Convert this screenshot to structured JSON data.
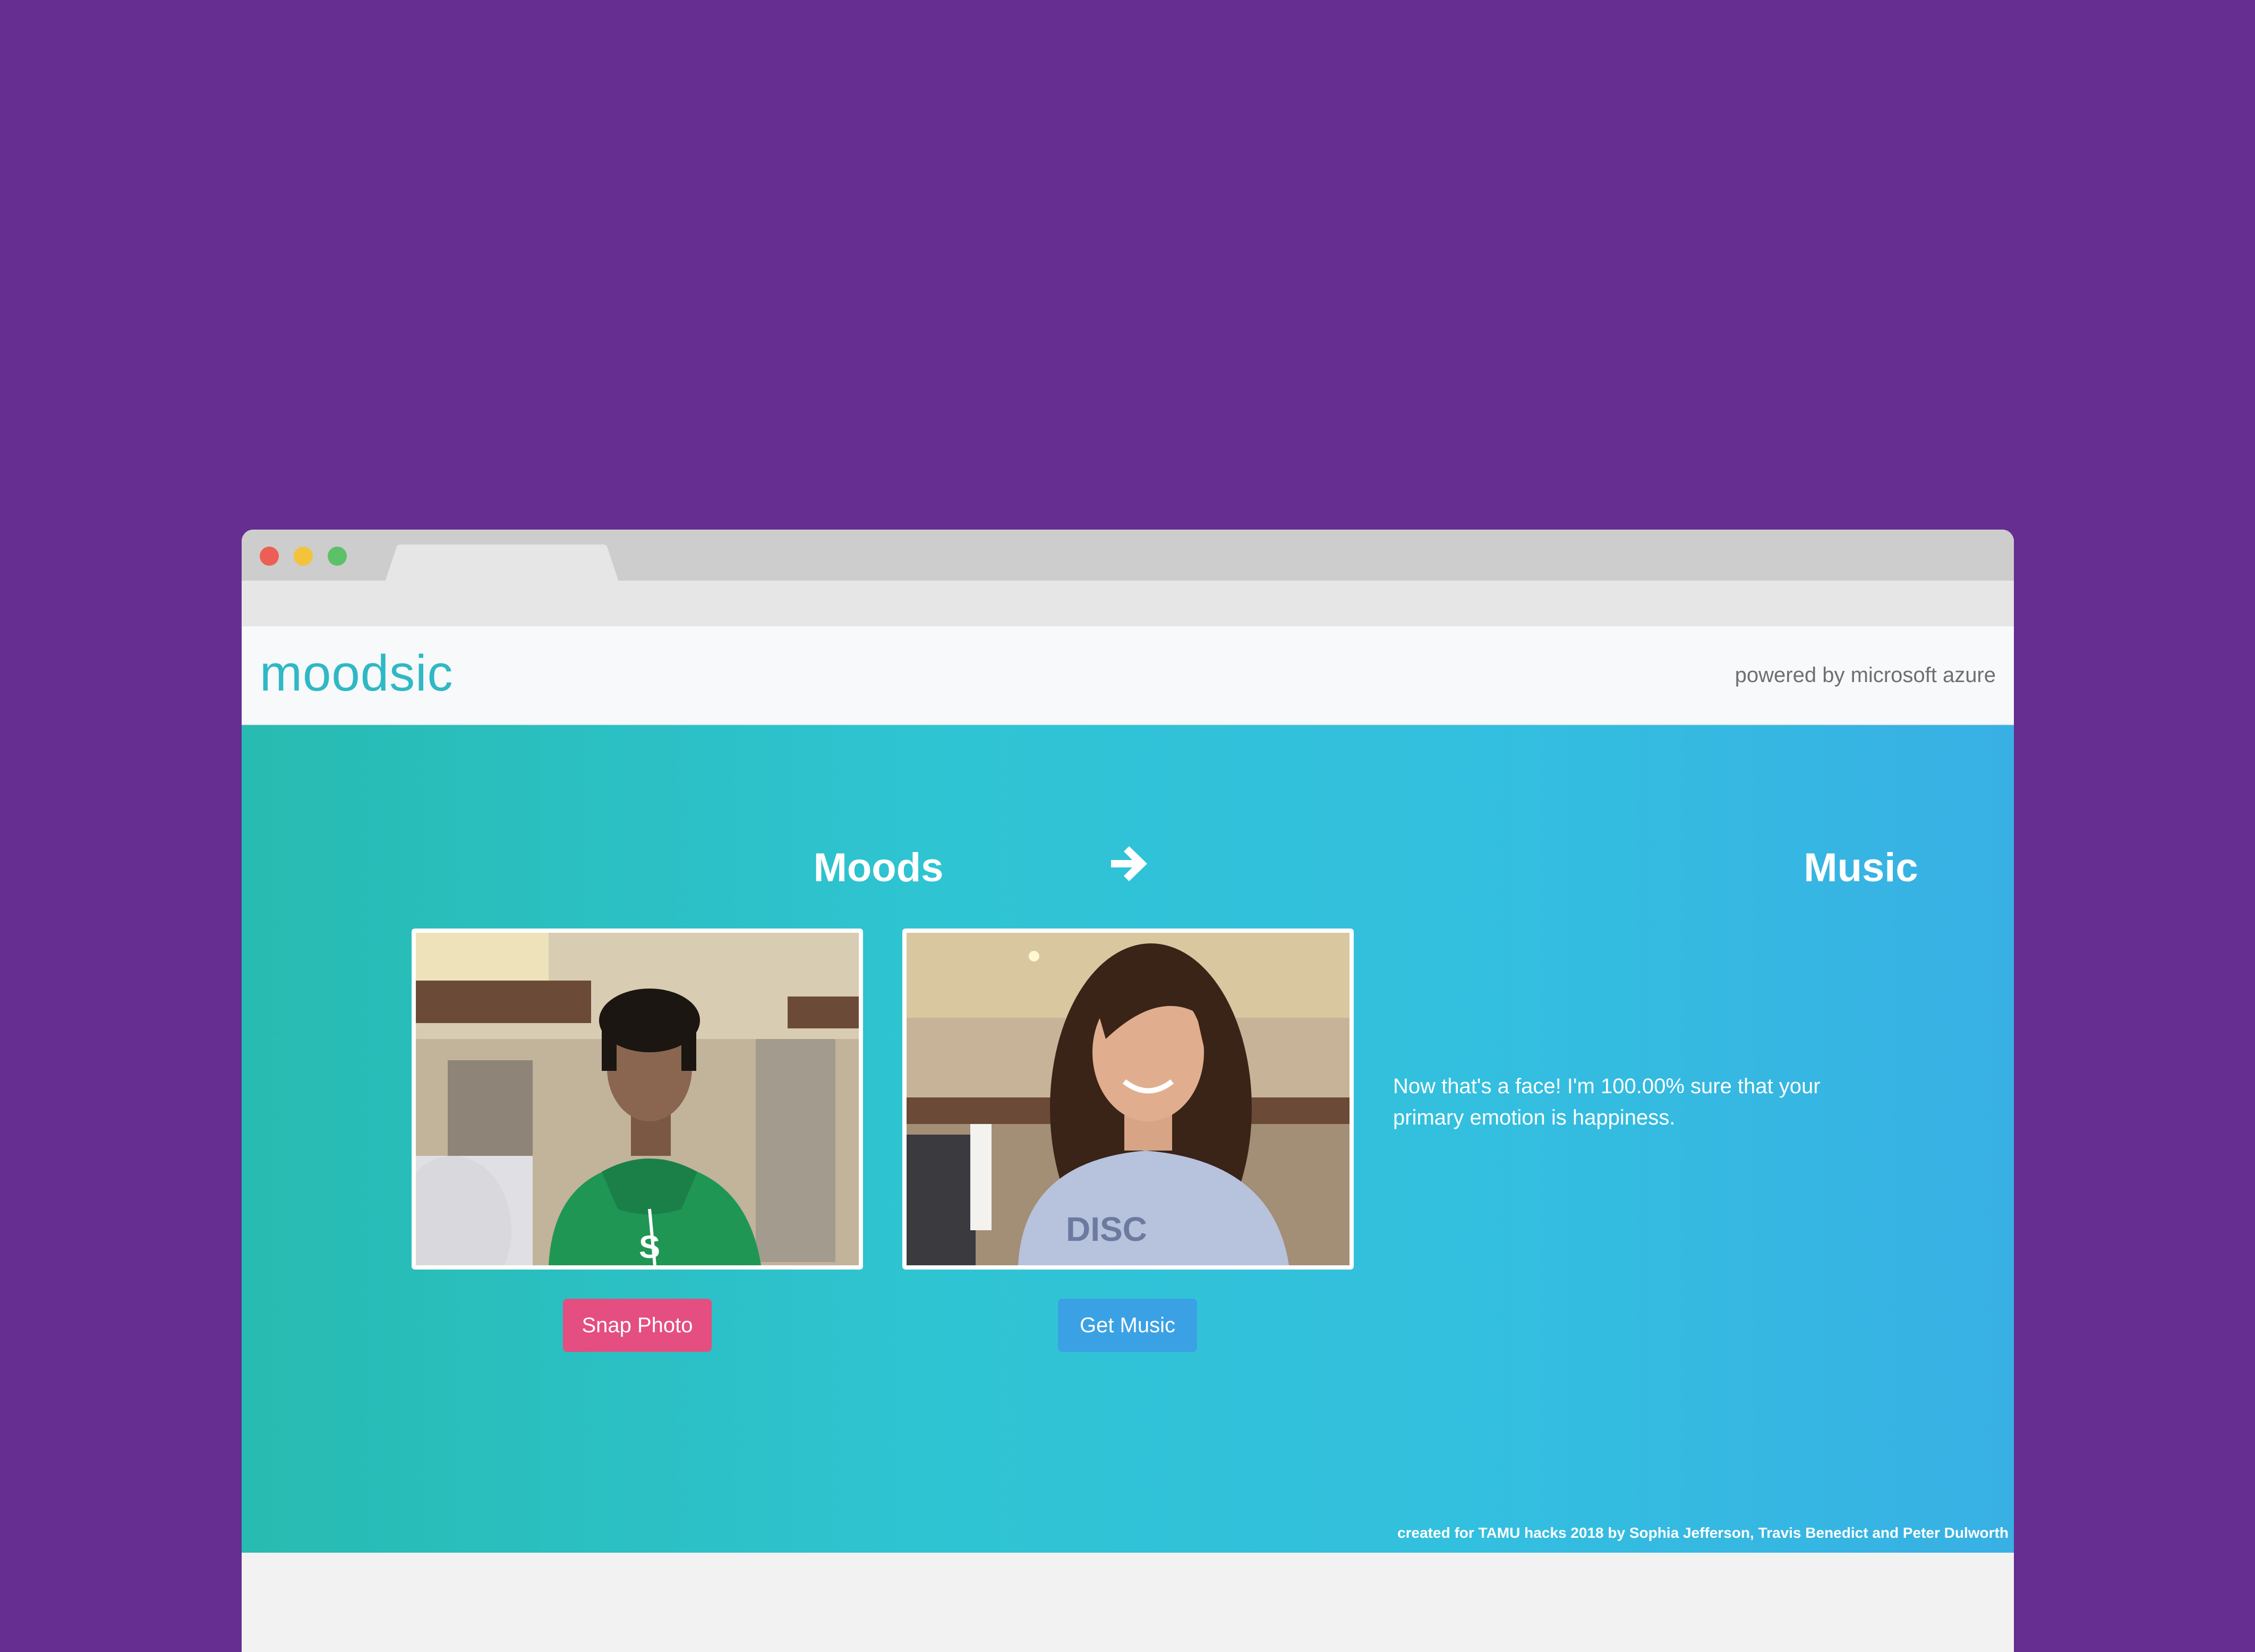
{
  "browser": {
    "window_controls": [
      "close",
      "minimize",
      "maximize"
    ]
  },
  "navbar": {
    "brand": "moodsic",
    "tagline": "powered by microsoft azure"
  },
  "main": {
    "moods_title": "Moods",
    "music_title": "Music",
    "arrow_icon": "arrow-right-icon",
    "snap_button": "Snap Photo",
    "music_button": "Get Music",
    "result_text": "Now that's a face! I'm 100.00% sure that your primary emotion is happiness.",
    "credits": "created for TAMU hacks 2018 by Sophia Jefferson, Travis Benedict and Peter Dulworth"
  },
  "colors": {
    "background": "#652e90",
    "brand": "#2fb8c5",
    "gradient_start": "#27bbb1",
    "gradient_end": "#38b0e4",
    "snap_button": "#e44e80",
    "music_button": "#3aa1e4"
  }
}
